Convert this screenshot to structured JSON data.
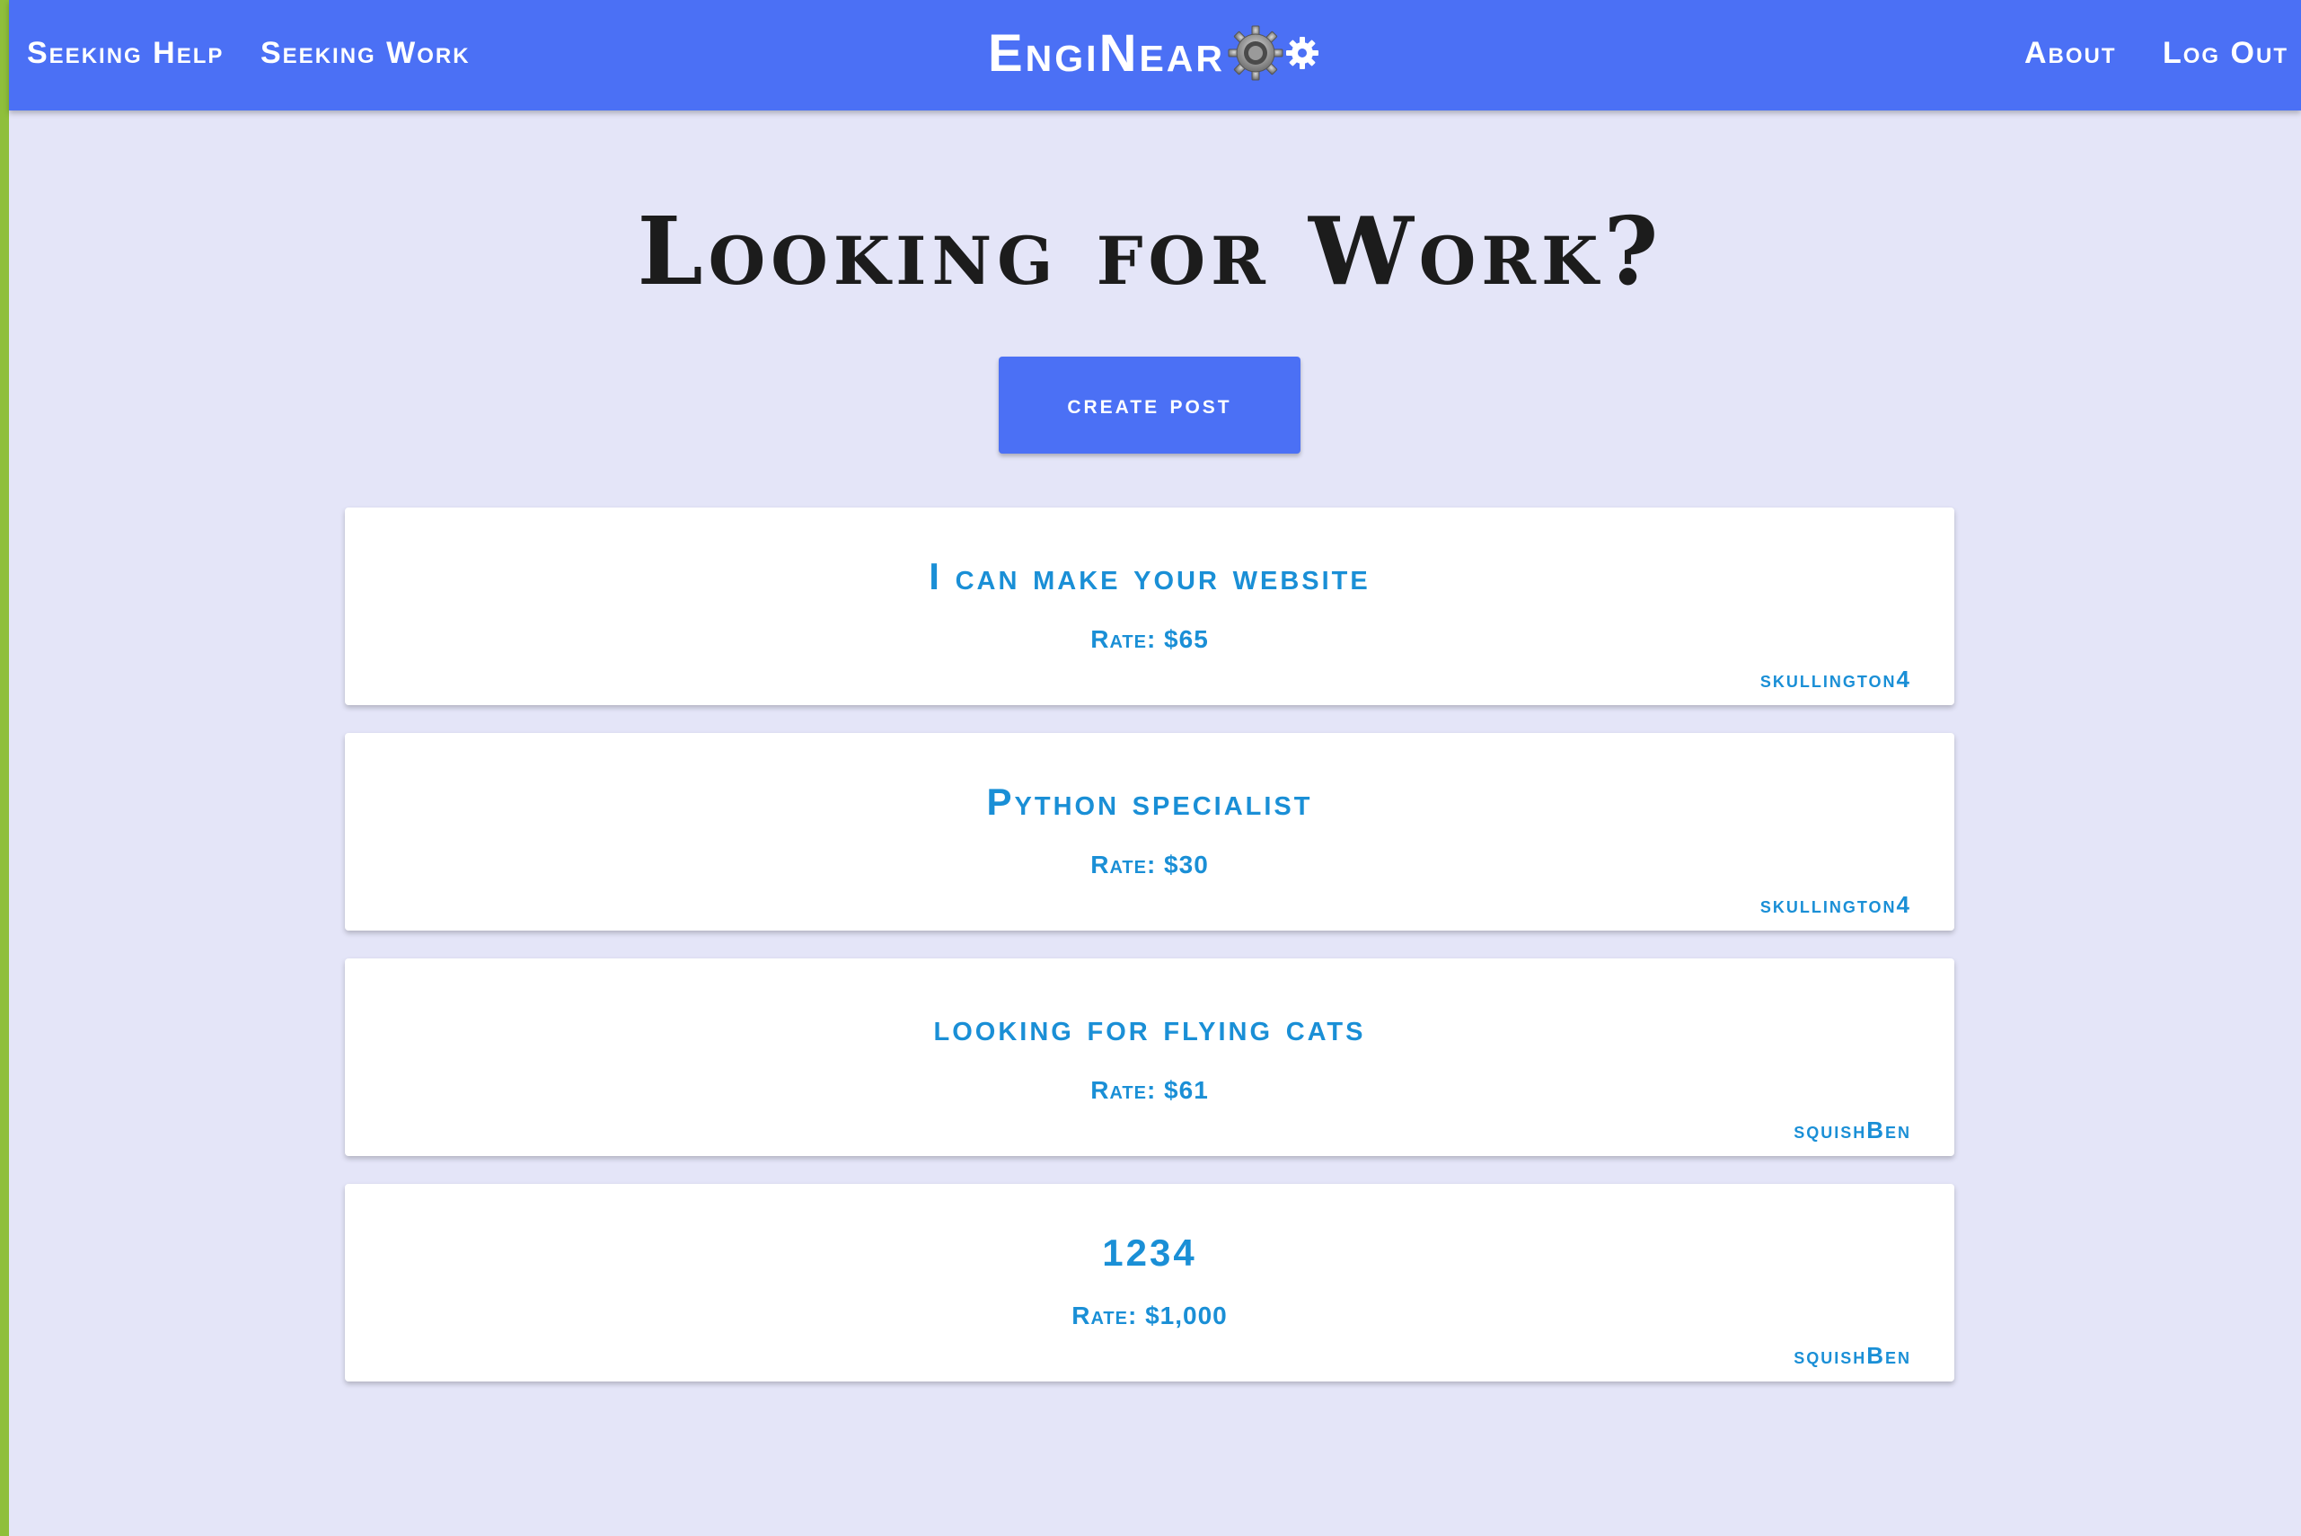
{
  "nav": {
    "left_links": [
      "Seeking Help",
      "Seeking Work"
    ],
    "brand": "EngiNear",
    "right_links": [
      "About",
      "Log Out"
    ]
  },
  "main": {
    "title": "Looking for Work?",
    "create_button_label": "create post",
    "posts": [
      {
        "title": "I can make your website",
        "rate": "Rate: $65",
        "author": "skullington4"
      },
      {
        "title": "Python specialist",
        "rate": "Rate: $30",
        "author": "skullington4"
      },
      {
        "title": "looking for flying cats",
        "rate": "Rate: $61",
        "author": "squishBen"
      },
      {
        "title": "1234",
        "rate": "Rate: $1,000",
        "author": "squishBen"
      }
    ]
  },
  "colors": {
    "nav_background": "#4b70f5",
    "page_background": "#e4e5f8",
    "accent_text": "#1a8fd6",
    "left_strip": "#8fbf3b"
  },
  "icons": {
    "brand_icons": [
      "large-gear-icon",
      "small-gear-icon"
    ]
  }
}
